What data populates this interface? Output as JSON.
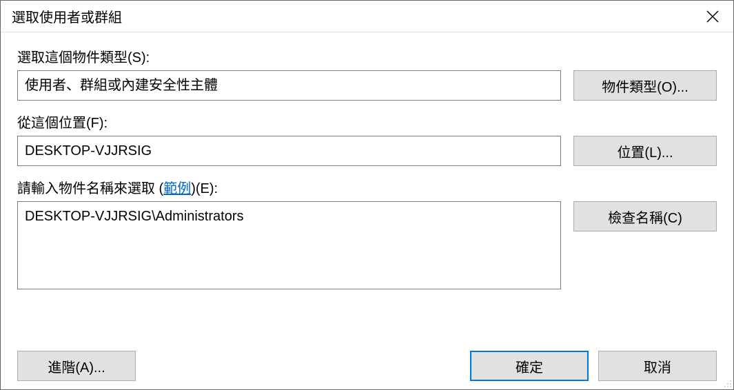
{
  "window": {
    "title": "選取使用者或群組"
  },
  "object_type": {
    "label": "選取這個物件類型(S):",
    "value": "使用者、群組或內建安全性主體",
    "button": "物件類型(O)..."
  },
  "location": {
    "label": "從這個位置(F):",
    "value": "DESKTOP-VJJRSIG",
    "button": "位置(L)..."
  },
  "object_name": {
    "label_prefix": "請輸入物件名稱來選取 (",
    "link_text": "範例",
    "label_suffix": ")(E):",
    "value": "DESKTOP-VJJRSIG\\Administrators",
    "button": "檢查名稱(C)"
  },
  "buttons": {
    "advanced": "進階(A)...",
    "ok": "確定",
    "cancel": "取消"
  }
}
